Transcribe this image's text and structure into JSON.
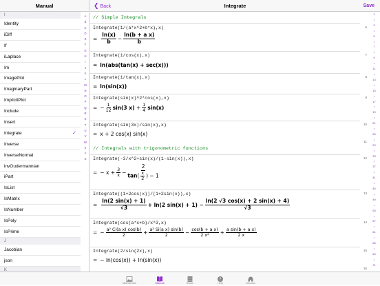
{
  "left_pane": {
    "title": "Manual",
    "sections": [
      {
        "header": "I",
        "items": [
          "Identity",
          "iDiff",
          "If",
          "iLaplace",
          "Im",
          "ImagePlot",
          "ImaginaryPart",
          "ImplicitPlot",
          "Include",
          "Insert",
          "Integrate",
          "Inverse",
          "InverseNormal",
          "invGudermannian",
          "iPart",
          "IsList",
          "IsMatrix",
          "IsNumber",
          "IsPoly",
          "IsPrime"
        ]
      },
      {
        "header": "J",
        "items": [
          "Jacobian",
          "json"
        ]
      },
      {
        "header": "K",
        "items": []
      }
    ],
    "selected_item": "Integrate",
    "index_letters": [
      "A",
      "B",
      "C",
      "D",
      "E",
      "F",
      "G",
      "H",
      "I",
      "J",
      "K",
      "L",
      "M",
      "N",
      "O",
      "P",
      "Q",
      "R",
      "S",
      "T",
      "U",
      "V",
      "W",
      "X",
      "Y",
      "Z"
    ]
  },
  "right_pane": {
    "back_label": "Back",
    "title": "Integrate",
    "save_label": "Save",
    "comment_1": "// Simple Integrals",
    "comment_2": "// Integrals with trigonometric functions",
    "entries": [
      {
        "input": "Integrate(1/(a*x^2+b*x),x)",
        "line": "6"
      },
      {
        "input": "Integrate(1/cos(x),x)",
        "line": "7"
      },
      {
        "input": "Integrate(1/tan(x),x)",
        "line": "8"
      },
      {
        "input": "Integrate(sin(x)^2*cos(x),x)",
        "line": "9"
      },
      {
        "input": "Integrate(sin(3x)/sin(x),x)",
        "line": "10"
      },
      {
        "input": "Integrate(-3/x^2+sin(x)/(1-sin(x)),x)",
        "line": "12"
      },
      {
        "input": "Integrate((1+2cos(x))/(1+2sin(x)),x)",
        "line": "13"
      },
      {
        "input": "Integrate(cos(a*x+b)/x^3,x)",
        "line": "14"
      },
      {
        "input": "Integrate(2/sin(2x),x)",
        "line": "15"
      }
    ],
    "line_numbers": [
      "6",
      "7",
      "8",
      "9",
      "10",
      "11",
      "12",
      "13",
      "14",
      "15",
      "16"
    ],
    "scroll_index": [
      "1",
      "•",
      "3",
      "•",
      "5",
      "•",
      "7",
      "•",
      "9",
      "•",
      "11",
      "•",
      "13",
      "•",
      "15",
      "•",
      "17",
      "•",
      "19",
      "•",
      "21",
      "•",
      "25",
      "•",
      "29",
      "•",
      "33",
      "•",
      "37",
      "•",
      "41",
      "•",
      "45",
      "•",
      "49",
      "•",
      "53",
      "•",
      "57",
      "•",
      "61",
      "•",
      "65",
      "•",
      "69",
      "•",
      "71"
    ]
  },
  "outputs": {
    "o1": {
      "n1": "ln(x)",
      "d1": "b",
      "n2": "ln(b + a x)",
      "d2": "b"
    },
    "o2": "ln(abs(tan(x) + sec(x)))",
    "o3": "ln(sin(x))",
    "o4": {
      "neg": "−",
      "n1": "1",
      "d1": "12",
      "t1": "sin(3 x)",
      "plus": "+",
      "n2": "1",
      "d2": "4",
      "t2": "sin(x)"
    },
    "o5": "x + 2 cos(x) sin(x)",
    "o6": {
      "a": "− x +",
      "n1": "3",
      "d1": "x",
      "minus": "−",
      "n2": "2",
      "den_a": "tan",
      "den_n": "x",
      "den_d": "2",
      "den_tail": ") − 1"
    },
    "o7": {
      "n1": "ln(2 sin(x) + 1)",
      "d1": "√3",
      "m1": "+ ln(2 sin(x) + 1) −",
      "n2": "ln(2 √3 cos(x) + 2 sin(x) + 4)",
      "d2": "√3"
    },
    "o8": {
      "n1": "a² Ci(a x) cos(b)",
      "d1": "2",
      "n2": "a² Si(a x) sin(b)",
      "d2": "2",
      "n3": "cos(b + a x)",
      "d3": "2 x²",
      "n4": "a sin(b + a x)",
      "d4": "2 x"
    },
    "o9": "− ln(cos(x)) + ln(sin(x))",
    "eq_sign": "="
  },
  "tabbar": {
    "tabs": [
      {
        "label": "MathStudio",
        "icon": "image-icon"
      },
      {
        "label": "Manual",
        "icon": "book-icon"
      },
      {
        "label": "Share",
        "icon": "stack-icon"
      },
      {
        "label": "Help",
        "icon": "question-icon"
      },
      {
        "label": "Discuss",
        "icon": "helmet-icon"
      }
    ],
    "active": "Manual"
  },
  "colors": {
    "accent": "#8e2bd0",
    "comment": "#168a23",
    "variable": "#d0202c"
  }
}
